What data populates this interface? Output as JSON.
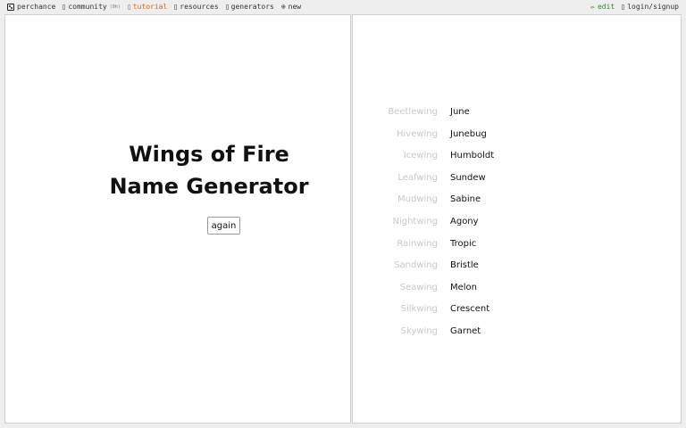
{
  "nav": {
    "site_name": "perchance",
    "community_label": "community",
    "community_badge": "(9h)",
    "tutorial_label": "tutorial",
    "resources_label": "resources",
    "generators_label": "generators",
    "new_label": "new",
    "edit_label": "edit",
    "login_label": "login/signup",
    "colors": {
      "tutorial": "#d2691e",
      "edit": "#2e8b2e"
    },
    "icons": [
      "die-icon",
      "community-icon",
      "tutorial-icon",
      "resources-icon",
      "generators-icon",
      "plus-circle-icon",
      "pencil-icon",
      "user-icon"
    ]
  },
  "main": {
    "title": "Wings of Fire Name Generator",
    "again_label": "again"
  },
  "results": [
    {
      "tribe": "Beetlewing",
      "name": "June"
    },
    {
      "tribe": "Hivewing",
      "name": "Junebug"
    },
    {
      "tribe": "Icewing",
      "name": "Humboldt"
    },
    {
      "tribe": "Leafwing",
      "name": "Sundew"
    },
    {
      "tribe": "Mudwing",
      "name": "Sabine"
    },
    {
      "tribe": "Nightwing",
      "name": "Agony"
    },
    {
      "tribe": "Rainwing",
      "name": "Tropic"
    },
    {
      "tribe": "Sandwing",
      "name": "Bristle"
    },
    {
      "tribe": "Seawing",
      "name": "Melon"
    },
    {
      "tribe": "Silkwing",
      "name": "Crescent"
    },
    {
      "tribe": "Skywing",
      "name": "Garnet"
    }
  ]
}
